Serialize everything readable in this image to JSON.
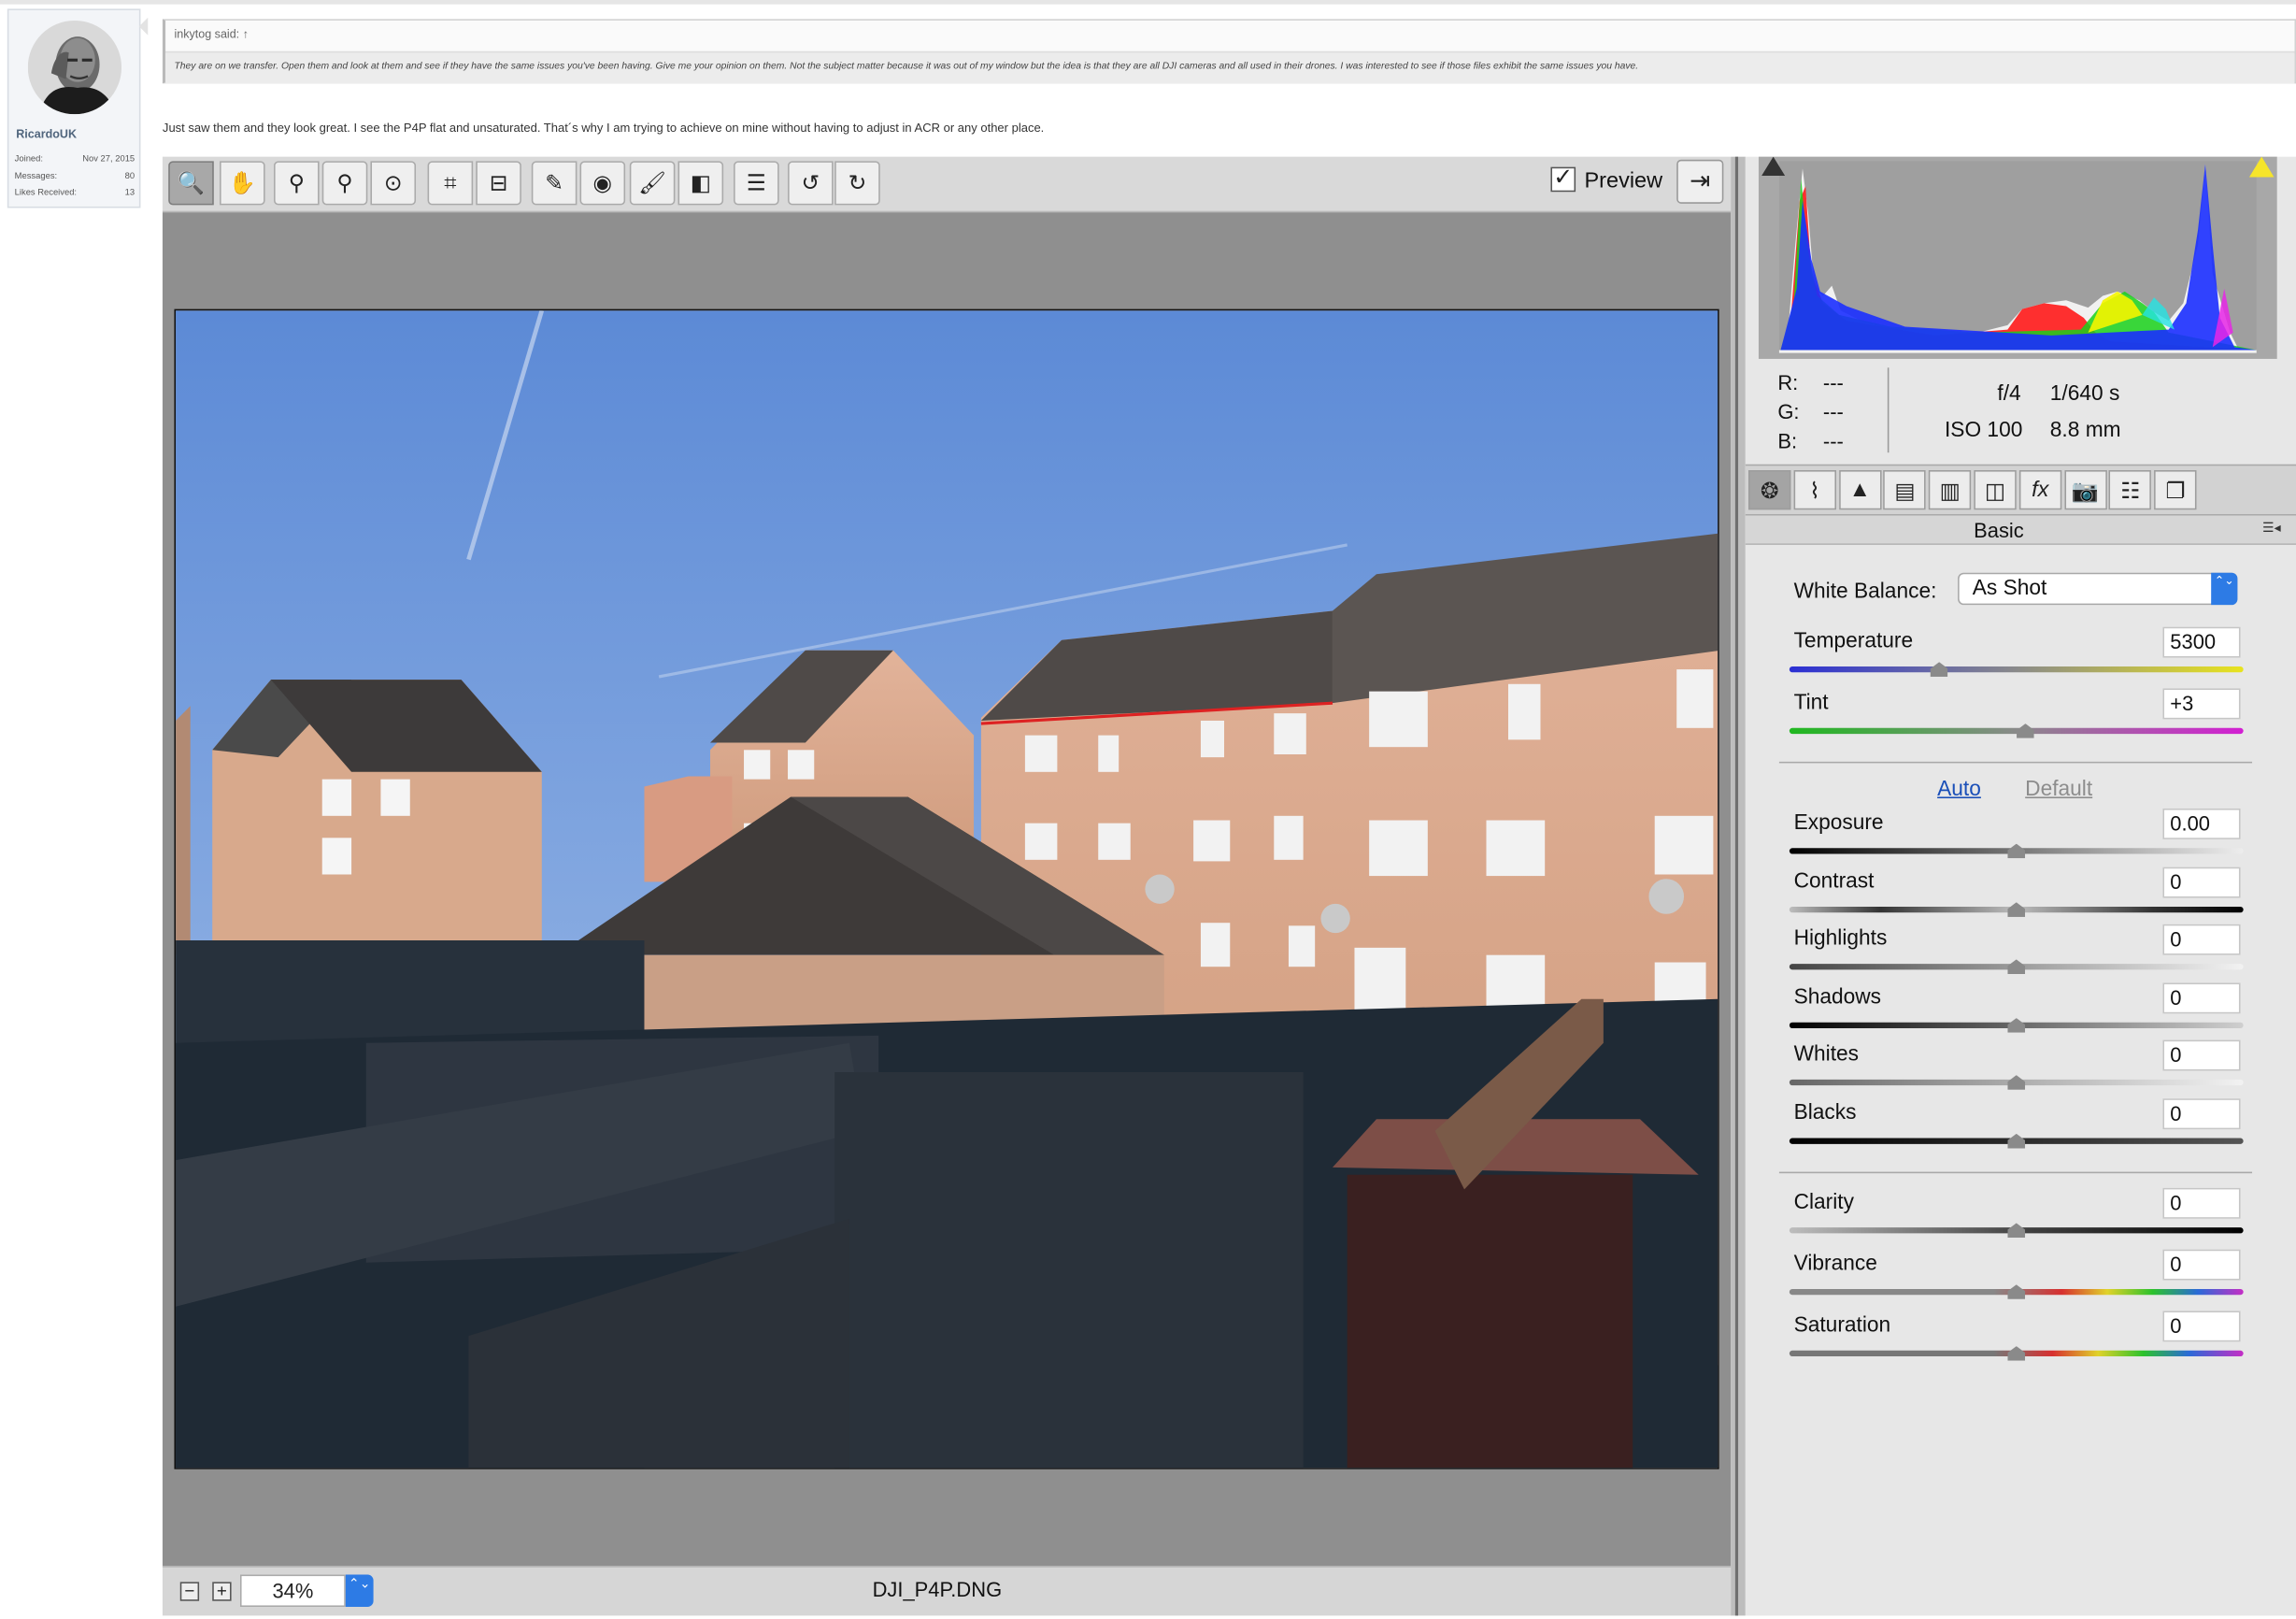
{
  "forum": {
    "username": "RicardoUK",
    "stats": [
      {
        "label": "Joined:",
        "value": "Nov 27, 2015"
      },
      {
        "label": "Messages:",
        "value": "80"
      },
      {
        "label": "Likes Received:",
        "value": "13"
      }
    ],
    "quote_author": "inkytog said: ↑",
    "quote_text": "They are on we transfer. Open them and look at them and see if they have the same issues you've been having. Give me your opinion on them. Not the subject matter because it was out of my window but the idea is that they are all DJI cameras and all used in their drones. I was interested to see if those files exhibit the same issues you have.",
    "post_text": "Just saw them and they look great. I see the P4P flat and unsaturated. That´s why I am trying to achieve on mine without having to adjust in ACR or any other place."
  },
  "toolbar": {
    "tools": [
      {
        "name": "zoom-tool",
        "icon": "magnifier-icon",
        "glyph": "🔍",
        "active": true
      },
      {
        "name": "hand-tool",
        "icon": "hand-icon",
        "glyph": "✋"
      },
      {
        "name": "white-balance-tool",
        "icon": "eyedropper-icon",
        "glyph": "⚲"
      },
      {
        "name": "color-sampler-tool",
        "icon": "color-sampler-icon",
        "glyph": "⚲"
      },
      {
        "name": "targeted-adjustment-tool",
        "icon": "target-icon",
        "glyph": "⊙"
      },
      {
        "name": "crop-tool",
        "icon": "crop-icon",
        "glyph": "⌗"
      },
      {
        "name": "straighten-tool",
        "icon": "straighten-icon",
        "glyph": "⊟"
      },
      {
        "name": "spot-removal-tool",
        "icon": "spot-removal-icon",
        "glyph": "✎"
      },
      {
        "name": "red-eye-tool",
        "icon": "eye-icon",
        "glyph": "◉"
      },
      {
        "name": "adjustment-brush-tool",
        "icon": "brush-icon",
        "glyph": "🖌"
      },
      {
        "name": "graduated-filter-tool",
        "icon": "graduated-filter-icon",
        "glyph": "◧"
      },
      {
        "name": "preferences-tool",
        "icon": "list-icon",
        "glyph": "☰"
      },
      {
        "name": "rotate-left-tool",
        "icon": "rotate-ccw-icon",
        "glyph": "↺"
      },
      {
        "name": "rotate-right-tool",
        "icon": "rotate-cw-icon",
        "glyph": "↻"
      }
    ],
    "preview_checked": "✓",
    "preview_label": "Preview",
    "fullscreen_glyph": "⇥"
  },
  "bottom": {
    "zoom_out": "−",
    "zoom_in": "+",
    "zoom_value": "34%",
    "stepper": "⌃⌄",
    "filename": "DJI_P4P.DNG"
  },
  "readout": {
    "r_label": "R:",
    "r_value": "---",
    "g_label": "G:",
    "g_value": "---",
    "b_label": "B:",
    "b_value": "---",
    "aperture": "f/4",
    "shutter": "1/640 s",
    "iso": "ISO 100",
    "focal": "8.8 mm"
  },
  "panel_tabs": [
    {
      "name": "tab-basic",
      "icon": "aperture-icon",
      "glyph": "❂",
      "active": true
    },
    {
      "name": "tab-tone-curve",
      "icon": "curve-icon",
      "glyph": "⌇"
    },
    {
      "name": "tab-detail",
      "icon": "triangle-icon",
      "glyph": "▲"
    },
    {
      "name": "tab-hsl",
      "icon": "hsl-icon",
      "glyph": "▤"
    },
    {
      "name": "tab-split-toning",
      "icon": "split-toning-icon",
      "glyph": "▥"
    },
    {
      "name": "tab-lens-corrections",
      "icon": "lens-icon",
      "glyph": "◫"
    },
    {
      "name": "tab-effects",
      "icon": "fx-icon",
      "glyph": "fx"
    },
    {
      "name": "tab-camera-calibration",
      "icon": "camera-icon",
      "glyph": "📷"
    },
    {
      "name": "tab-presets",
      "icon": "sliders-icon",
      "glyph": "☷"
    },
    {
      "name": "tab-snapshots",
      "icon": "snapshots-icon",
      "glyph": "❐"
    }
  ],
  "panel": {
    "title": "Basic",
    "menu_glyph": "☰◂",
    "wb_label": "White Balance:",
    "wb_value": "As Shot",
    "wb_stepper": "⌃⌄",
    "auto_label": "Auto",
    "default_label": "Default",
    "sliders": [
      {
        "key": "temperature",
        "label": "Temperature",
        "value": "5300",
        "position": 0.33
      },
      {
        "key": "tint",
        "label": "Tint",
        "value": "+3",
        "position": 0.52
      },
      {
        "key": "exposure",
        "label": "Exposure",
        "value": "0.00",
        "position": 0.5
      },
      {
        "key": "contrast",
        "label": "Contrast",
        "value": "0",
        "position": 0.5
      },
      {
        "key": "highlights",
        "label": "Highlights",
        "value": "0",
        "position": 0.5
      },
      {
        "key": "shadows",
        "label": "Shadows",
        "value": "0",
        "position": 0.5
      },
      {
        "key": "whites",
        "label": "Whites",
        "value": "0",
        "position": 0.5
      },
      {
        "key": "blacks",
        "label": "Blacks",
        "value": "0",
        "position": 0.5
      },
      {
        "key": "clarity",
        "label": "Clarity",
        "value": "0",
        "position": 0.5
      },
      {
        "key": "vibrance",
        "label": "Vibrance",
        "value": "0",
        "position": 0.5
      },
      {
        "key": "saturation",
        "label": "Saturation",
        "value": "0",
        "position": 0.5
      }
    ]
  }
}
